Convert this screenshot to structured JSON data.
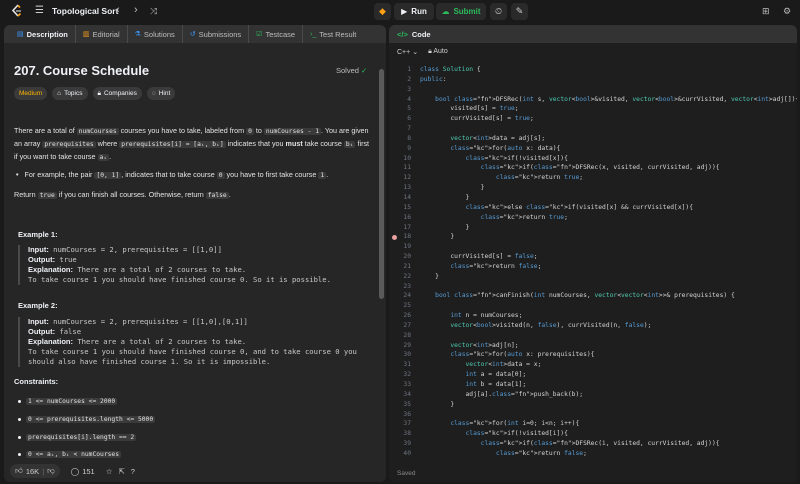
{
  "topbar": {
    "title": "Topological Sort",
    "run_label": "Run",
    "submit_label": "Submit"
  },
  "left_tabs": [
    {
      "label": "Description",
      "icon": "document-icon"
    },
    {
      "label": "Editorial",
      "icon": "book-icon"
    },
    {
      "label": "Solutions",
      "icon": "flask-icon"
    },
    {
      "label": "Submissions",
      "icon": "history-icon"
    },
    {
      "label": "Testcase",
      "icon": "checkbox-icon"
    },
    {
      "label": "Test Result",
      "icon": "terminal-icon"
    }
  ],
  "problem": {
    "title": "207. Course Schedule",
    "status": "Solved",
    "chips": {
      "difficulty": "Medium",
      "topics": "Topics",
      "companies": "Companies",
      "hint": "Hint"
    },
    "p1": {
      "a": "There are a total of ",
      "code1": "numCourses",
      "b": " courses you have to take, labeled from ",
      "code2": "0",
      "c": " to ",
      "code3": "numCourses - 1",
      "d": ". You are given an array ",
      "code4": "prerequisites",
      "e": " where ",
      "code5": "prerequisites[i] = [aᵢ, bᵢ]",
      "f": " indicates that you ",
      "strong": "must",
      "g": " take course ",
      "sub1": "bᵢ",
      "h": " first if you want to take course ",
      "sub2": "aᵢ",
      "i": "."
    },
    "bullet": {
      "a": "For example, the pair ",
      "code1": "[0, 1]",
      "b": ", indicates that to take course ",
      "code2": "0",
      "c": " you have to first take course ",
      "code3": "1",
      "d": "."
    },
    "p2": {
      "a": "Return ",
      "code1": "true",
      "b": " if you can finish all courses. Otherwise, return ",
      "code2": "false",
      "c": "."
    },
    "example1": {
      "heading": "Example 1:",
      "input_label": "Input:",
      "input": "numCourses = 2, prerequisites = [[1,0]]",
      "output_label": "Output:",
      "output": "true",
      "expl_label": "Explanation:",
      "expl1": "There are a total of 2 courses to take.",
      "expl2": "To take course 1 you should have finished course 0. So it is possible."
    },
    "example2": {
      "heading": "Example 2:",
      "input_label": "Input:",
      "input": "numCourses = 2, prerequisites = [[1,0],[0,1]]",
      "output_label": "Output:",
      "output": "false",
      "expl_label": "Explanation:",
      "expl1": "There are a total of 2 courses to take.",
      "expl2": "To take course 1 you should have finished course 0, and to take course 0 you",
      "expl3": "should also have finished course 1. So it is impossible."
    },
    "constraints_heading": "Constraints:",
    "constraints": [
      "1 <= numCourses <= 2000",
      "0 <= prerequisites.length <= 5000",
      "prerequisites[i].length == 2",
      "0 <= aᵢ, bᵢ < numCourses"
    ]
  },
  "footer": {
    "likes": "16K",
    "comments": "151"
  },
  "code_panel": {
    "tab_label": "Code",
    "language": "C++",
    "mode": "Auto",
    "status": "Saved",
    "lines": [
      "class Solution {",
      "public:",
      "",
      "    bool DFSRec(int s, vector<bool>&visited, vector<bool>&currVisited, vector<int>adj[]){",
      "        visited[s] = true;",
      "        currVisited[s] = true;",
      "",
      "        vector<int>data = adj[s];",
      "        for(auto x: data){",
      "            if(!visited[x]){",
      "                if(DFSRec(x, visited, currVisited, adj)){",
      "                    return true;",
      "                }",
      "            }",
      "            else if(visited[x] && currVisited[x]){",
      "                return true;",
      "            }",
      "        }",
      "",
      "        currVisited[s] = false;",
      "        return false;",
      "    }",
      "",
      "    bool canFinish(int numCourses, vector<vector<int>>& prerequisites) {",
      "",
      "        int n = numCourses;",
      "        vector<bool>visited(n, false), currVisited(n, false);",
      "",
      "        vector<int>adj[n];",
      "        for(auto x: prerequisites){",
      "            vector<int>data = x;",
      "            int a = data[0];",
      "            int b = data[1];",
      "            adj[a].push_back(b);",
      "        }",
      "",
      "        for(int i=0; i<n; i++){",
      "            if(!visited[i]){",
      "                if(DFSRec(i, visited, currVisited, adj)){",
      "                    return false;",
      "                }"
    ]
  }
}
